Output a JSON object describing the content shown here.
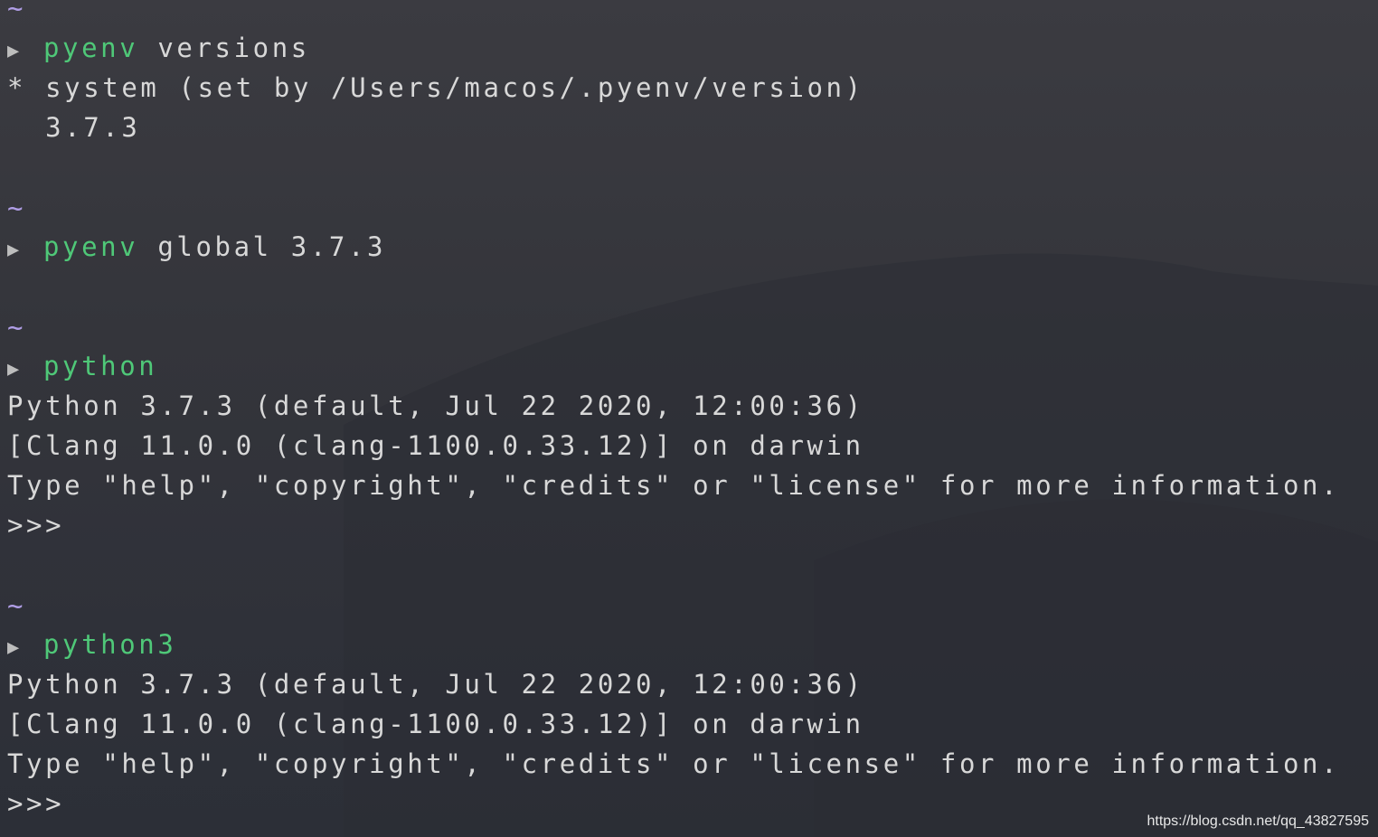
{
  "terminal": {
    "blocks": [
      {
        "tilde": "~"
      },
      {
        "prompt": "▶",
        "command": "pyenv",
        "args": " versions"
      },
      {
        "output": "* system (set by /Users/macos/.pyenv/version)"
      },
      {
        "output": "  3.7.3"
      },
      {
        "tilde": "~"
      },
      {
        "prompt": "▶",
        "command": "pyenv",
        "args": " global 3.7.3"
      },
      {
        "tilde": "~"
      },
      {
        "prompt": "▶",
        "command": "python",
        "args": ""
      },
      {
        "output": "Python 3.7.3 (default, Jul 22 2020, 12:00:36)"
      },
      {
        "output": "[Clang 11.0.0 (clang-1100.0.33.12)] on darwin"
      },
      {
        "output": "Type \"help\", \"copyright\", \"credits\" or \"license\" for more information."
      },
      {
        "output": ">>>"
      },
      {
        "tilde": "~"
      },
      {
        "prompt": "▶",
        "command": "python3",
        "args": ""
      },
      {
        "output": "Python 3.7.3 (default, Jul 22 2020, 12:00:36)"
      },
      {
        "output": "[Clang 11.0.0 (clang-1100.0.33.12)] on darwin"
      },
      {
        "output": "Type \"help\", \"copyright\", \"credits\" or \"license\" for more information."
      },
      {
        "output": ">>>"
      }
    ]
  },
  "watermark": "https://blog.csdn.net/qq_43827595",
  "colors": {
    "tilde": "#b09ee6",
    "command": "#4fc878",
    "text": "#d8d8d8",
    "background": "#34353b"
  }
}
